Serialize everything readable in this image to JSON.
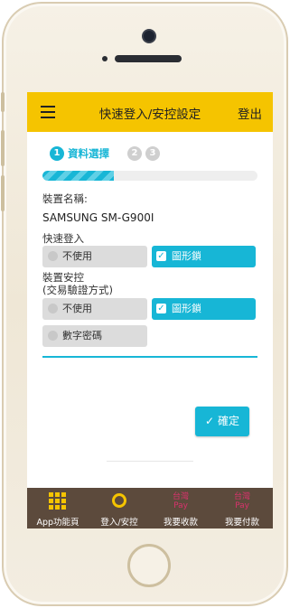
{
  "header": {
    "title": "快速登入/安控設定",
    "logout_label": "登出"
  },
  "stepper": {
    "steps": [
      "1",
      "2",
      "3"
    ],
    "current_label": "資料選擇",
    "progress_fraction": 0.33
  },
  "device": {
    "name_label": "裝置名稱:",
    "name_value": "SAMSUNG SM-G900I"
  },
  "quick_login": {
    "label": "快速登入",
    "options": [
      "不使用",
      "圖形鎖"
    ],
    "selected": "圖形鎖"
  },
  "device_security": {
    "label_line1": "裝置安控",
    "label_line2": "(交易驗證方式)",
    "options": [
      "不使用",
      "圖形鎖",
      "數字密碼"
    ],
    "selected": "圖形鎖"
  },
  "confirm_button": {
    "label": "確定",
    "icon": "check-icon"
  },
  "bottom_nav": [
    {
      "label": "App功能頁",
      "icon": "grid-icon"
    },
    {
      "label": "登入/安控",
      "icon": "gear-icon"
    },
    {
      "label": "我要收款",
      "icon": "taiwan-pay-icon",
      "icon_text_top": "台灣",
      "icon_text_bottom": "Pay"
    },
    {
      "label": "我要付款",
      "icon": "taiwan-pay-icon",
      "icon_text_top": "台灣",
      "icon_text_bottom": "Pay"
    }
  ],
  "colors": {
    "accent": "#17b6d6",
    "header": "#f5c400",
    "bottom_bar": "#5c4a3c",
    "pay_logo": "#d8336c"
  }
}
